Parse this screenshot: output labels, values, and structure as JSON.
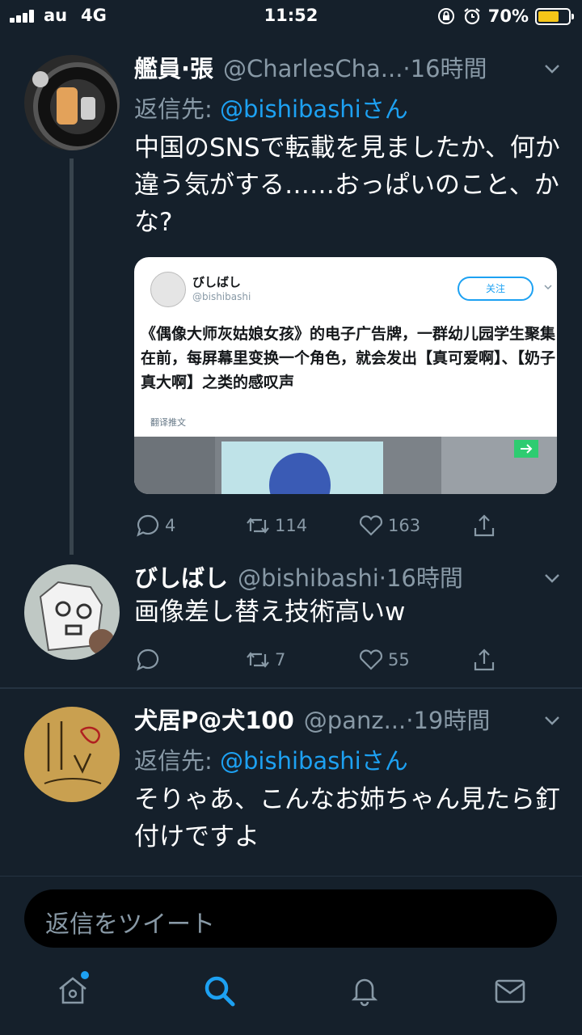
{
  "status": {
    "carrier": "au",
    "network": "4G",
    "time": "11:52",
    "battery": "70%",
    "battery_level": 0.7
  },
  "tweets": [
    {
      "name": "艦員·張",
      "handle": "@CharlesCha...",
      "time": "·16時間",
      "reply_label": "返信先: ",
      "reply_to": "@bishibashiさん",
      "text": "中国のSNSで転載を見ましたか、何か違う気がする……おっぱいのこと、かな?",
      "replies": "4",
      "retweets": "114",
      "likes": "163",
      "quoted": {
        "name": "びしばし",
        "handle": "@bishibashi",
        "follow": "关注",
        "text": "《偶像大师灰姑娘女孩》的电子广告牌，一群幼儿园学生聚集在前，每屏幕里变换一个角色，就会发出【真可爱啊】、【奶子真大啊】之类的感叹声",
        "translate": "翻译推文"
      }
    },
    {
      "name": "びしばし",
      "handle": "@bishibashi",
      "time": "·16時間",
      "text": "画像差し替え技術高いw",
      "replies": "",
      "retweets": "7",
      "likes": "55"
    },
    {
      "name": "犬居P@犬100",
      "handle": "@panz...",
      "time": "·19時間",
      "reply_label": "返信先: ",
      "reply_to": "@bishibashiさん",
      "text": "そりゃあ、こんなお姉ちゃん見たら釘付けですよ"
    }
  ],
  "compose": {
    "placeholder": "返信をツイート"
  },
  "colors": {
    "background": "#15202b",
    "accent": "#1da1f2",
    "secondary_text": "#8899a6",
    "battery": "#f5c518"
  },
  "tabs": [
    "home-icon",
    "search-icon",
    "notifications-icon",
    "messages-icon"
  ]
}
